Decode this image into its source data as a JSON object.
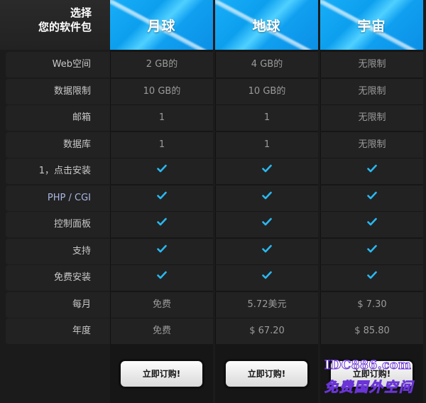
{
  "title_line1": "选择",
  "title_line2": "您的软件包",
  "plans": [
    {
      "name": "月球",
      "order_label": "立即订购!"
    },
    {
      "name": "地球",
      "order_label": "立即订购!"
    },
    {
      "name": "宇宙",
      "order_label": "立即订购!"
    }
  ],
  "rows": [
    {
      "label": "Web空间",
      "values": [
        "2 GB的",
        "4 GB的",
        "无限制"
      ]
    },
    {
      "label": "数据限制",
      "values": [
        "10 GB的",
        "10 GB的",
        "无限制"
      ]
    },
    {
      "label": "邮箱",
      "values": [
        "1",
        "1",
        "无限制"
      ]
    },
    {
      "label": "数据库",
      "values": [
        "1",
        "1",
        "无限制"
      ]
    },
    {
      "label": "1，点击安装",
      "values": [
        "check",
        "check",
        "check"
      ]
    },
    {
      "label": "PHP / CGI",
      "values": [
        "check",
        "check",
        "check"
      ]
    },
    {
      "label": "控制面板",
      "values": [
        "check",
        "check",
        "check"
      ]
    },
    {
      "label": "支持",
      "values": [
        "check",
        "check",
        "check"
      ]
    },
    {
      "label": "免费安装",
      "values": [
        "check",
        "check",
        "check"
      ]
    },
    {
      "label": "每月",
      "values": [
        "免费",
        "5.72美元",
        "$ 7.30"
      ]
    },
    {
      "label": "年度",
      "values": [
        "免费",
        "$ 67.20",
        "$ 85.80"
      ]
    }
  ],
  "colors": {
    "header_blue": "#18aef8",
    "check": "#2ab8f0"
  },
  "watermark": {
    "top": "IDC886.com",
    "bottom": "免费国外空间"
  }
}
